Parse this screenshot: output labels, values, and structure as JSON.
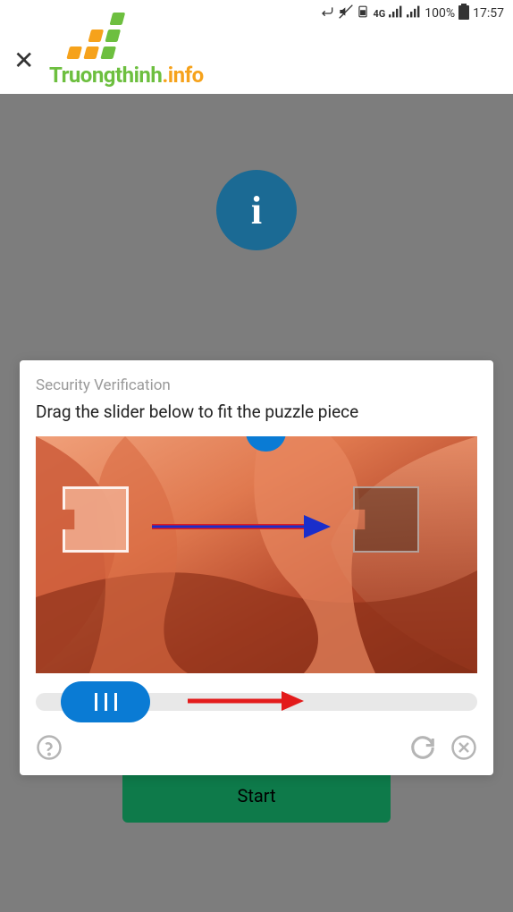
{
  "status_bar": {
    "network_label": "4G",
    "battery_percent": "100%",
    "time": "17:57"
  },
  "logo": {
    "text_part1": "Truongthinh",
    "text_part2": ".info"
  },
  "background": {
    "start_button_label": "Start"
  },
  "captcha": {
    "title": "Security Verification",
    "instruction": "Drag the slider below to fit the puzzle piece"
  }
}
